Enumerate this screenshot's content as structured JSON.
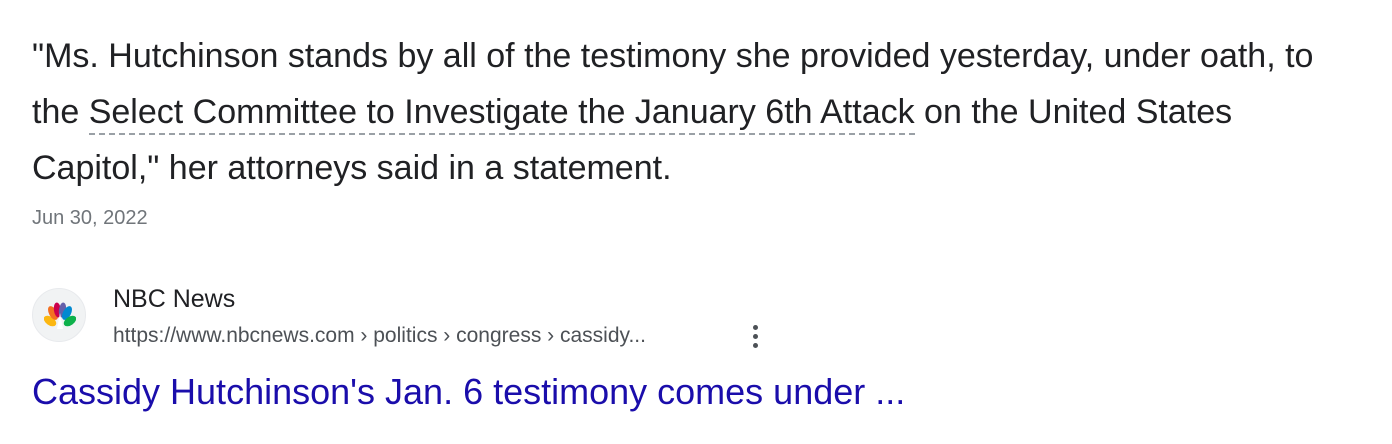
{
  "snippet": {
    "part1": "\"Ms. Hutchinson stands by all of the testimony she provided yesterday, under oath, to the ",
    "entity": "Select Committee to Investigate the January 6th Attack",
    "part2": " on the United States Capitol,\" her attorneys said in a statement.",
    "date": "Jun 30, 2022"
  },
  "result": {
    "favicon": "nbc-peacock-icon",
    "site_name": "NBC News",
    "url": "https://www.nbcnews.com › politics › congress › cassidy...",
    "more_icon": "more-vert-icon",
    "title": "Cassidy Hutchinson's Jan. 6 testimony comes under ..."
  },
  "colors": {
    "link": "#1a0dab",
    "text": "#202124",
    "meta": "#70757a",
    "url": "#4d5156"
  }
}
